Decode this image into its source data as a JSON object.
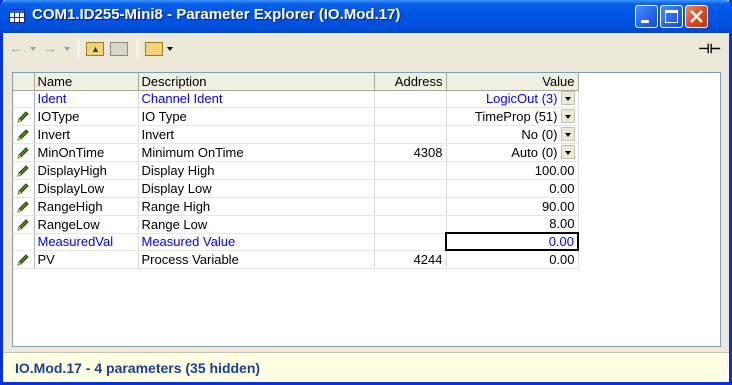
{
  "window": {
    "title": "COM1.ID255-Mini8 - Parameter Explorer (IO.Mod.17)",
    "title_color": "#ffffff",
    "accent": "#0054e3"
  },
  "toolbar": {
    "back_icon": "back-arrow-icon",
    "forward_icon": "forward-arrow-icon",
    "up_folder_icon": "folder-up-icon",
    "folder_icon": "folder-icon",
    "open_folder_icon": "open-folder-icon",
    "pin_icon": "pin-icon"
  },
  "grid": {
    "headers": {
      "name": "Name",
      "description": "Description",
      "address": "Address",
      "value": "Value"
    },
    "rows": [
      {
        "editable": false,
        "color": "#0000ff",
        "name": "Ident",
        "description": "Channel Ident",
        "address": "",
        "value": "LogicOut (3)",
        "dropdown": true
      },
      {
        "editable": true,
        "color": "#000000",
        "name": "IOType",
        "description": "IO Type",
        "address": "",
        "value": "TimeProp (51)",
        "dropdown": true
      },
      {
        "editable": true,
        "color": "#000000",
        "name": "Invert",
        "description": "Invert",
        "address": "",
        "value": "No (0)",
        "dropdown": true
      },
      {
        "editable": true,
        "color": "#000000",
        "name": "MinOnTime",
        "description": "Minimum  OnTime",
        "address": "4308",
        "value": "Auto (0)",
        "dropdown": true
      },
      {
        "editable": true,
        "color": "#000000",
        "name": "DisplayHigh",
        "description": "Display High",
        "address": "",
        "value": "100.00",
        "dropdown": false
      },
      {
        "editable": true,
        "color": "#000000",
        "name": "DisplayLow",
        "description": "Display Low",
        "address": "",
        "value": "0.00",
        "dropdown": false
      },
      {
        "editable": true,
        "color": "#000000",
        "name": "RangeHigh",
        "description": "Range High",
        "address": "",
        "value": "90.00",
        "dropdown": false
      },
      {
        "editable": true,
        "color": "#000000",
        "name": "RangeLow",
        "description": "Range Low",
        "address": "",
        "value": "8.00",
        "dropdown": false
      },
      {
        "editable": false,
        "color": "#0000ff",
        "name": "MeasuredVal",
        "description": "Measured Value",
        "address": "",
        "value": "0.00",
        "dropdown": false,
        "selected": true
      },
      {
        "editable": true,
        "color": "#000000",
        "name": "PV",
        "description": "Process Variable",
        "address": "4244",
        "value": "0.00",
        "dropdown": false
      }
    ]
  },
  "status": {
    "text": "IO.Mod.17  -  4 parameters (35 hidden)",
    "color": "#1a3e9a",
    "background": "#ffffe1"
  }
}
